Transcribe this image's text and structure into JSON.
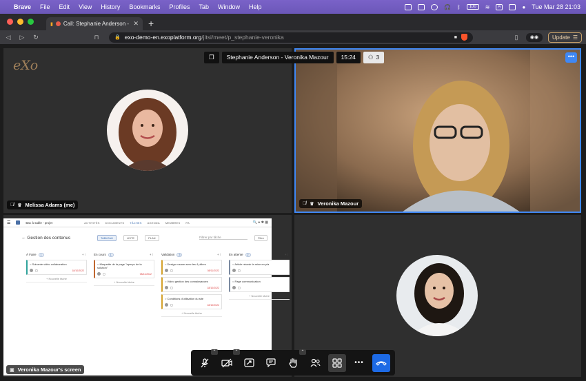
{
  "menubar": {
    "app_name": "Brave",
    "items": [
      "File",
      "Edit",
      "View",
      "History",
      "Bookmarks",
      "Profiles",
      "Tab",
      "Window",
      "Help"
    ],
    "clock": "Tue Mar 28  21:03",
    "battery_label": "100"
  },
  "browser": {
    "tab_title": "Call: Stephanie Anderson - V",
    "url_host": "exo-demo-en.exoplatform.org",
    "url_path": "/jitsi/meet/p_stephanie-veronika",
    "update_label": "Update"
  },
  "meeting": {
    "title": "Stephanie Anderson - Veronika Mazour",
    "duration": "15:24",
    "participant_count": "3",
    "more_label": "•••",
    "logo_text": "eXo",
    "participants": [
      {
        "name": "Melissa Adams (me)"
      },
      {
        "name": "Veronika Mazour"
      }
    ],
    "screen_share_label": "Veronika Mazour's screen",
    "accent_color": "#3f88f5"
  },
  "shared_screen": {
    "project": "Bac à sable - projet",
    "nav": [
      "ACTIVITÉS",
      "DOCUMENTS",
      "TÂCHES",
      "AGENDA",
      "MEMBRES",
      "PA"
    ],
    "page_title": "Gestion des contenus",
    "views": [
      "TABLEAU",
      "LISTE",
      "PLAN"
    ],
    "filter_placeholder": "Filtrer par tâche",
    "filter_button": "Filtre",
    "add_task": "+ Nouvelle tâche",
    "columns": [
      {
        "title": "À Faire",
        "count": "1",
        "cards": [
          {
            "text": "Suivante vidéo collaboration",
            "date": "18/10/2022",
            "color": "#2fa39b"
          }
        ]
      },
      {
        "title": "En cours",
        "count": "1",
        "cards": [
          {
            "text": "Maquette de la page \"aperçu de la solution\"",
            "date": "08/11/2022",
            "color": "#c0662e"
          }
        ]
      },
      {
        "title": "Validation",
        "count": "3",
        "cards": [
          {
            "text": "Design rosace avec les 4 piliers",
            "date": "08/11/2022",
            "color": "#d4a12a"
          },
          {
            "text": "Vidéo gestion des connaissances",
            "date": "18/10/2022",
            "color": "#d4a12a"
          },
          {
            "text": "Conditions d'utilisation du site",
            "date": "18/10/2022",
            "color": "#d4a12a"
          }
        ]
      },
      {
        "title": "En attente",
        "count": "2",
        "cards": [
          {
            "text": "Article réussir la mise en pla",
            "date": "",
            "color": "#7b8aa0"
          },
          {
            "text": "Page communication",
            "date": "",
            "color": "#7b8aa0"
          }
        ]
      }
    ]
  }
}
